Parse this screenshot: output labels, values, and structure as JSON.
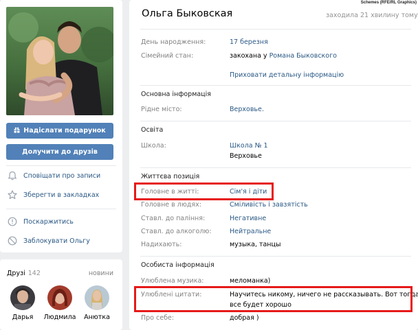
{
  "watermark": "Schemes (RFE/RL Graphics)",
  "profile": {
    "name": "Ольга Быковская",
    "online_status": "заходила 21 хвилину тому"
  },
  "actions": {
    "send_gift": "Надіслати подарунок",
    "add_friend": "Долучити до друзів",
    "notify": "Сповіщати про записи",
    "bookmark": "Зберегти в закладках",
    "report": "Поскаржитись",
    "block": "Заблокувати Ольгу"
  },
  "friends": {
    "title": "Друзі",
    "count": "142",
    "more": "новини",
    "items": [
      {
        "name": "Дарья"
      },
      {
        "name": "Людмила"
      },
      {
        "name": "Анютка"
      }
    ]
  },
  "info": {
    "birthday_label": "День народження:",
    "birthday_value": "17 березня",
    "family_label": "Сімейний стан:",
    "family_prefix": "закохана у",
    "family_partner": "Романа Быковского",
    "hide_details": "Приховати детальну інформацію",
    "basic_title": "Основна інформація",
    "hometown_label": "Рідне місто:",
    "hometown_value": "Верховье.",
    "education_title": "Освіта",
    "school_label": "Школа:",
    "school_value": "Школа № 1",
    "school_city": "Верховье",
    "life_title": "Життєва позиція",
    "main_life_label": "Головне в житті:",
    "main_life_value": "Сім'я і діти",
    "main_people_label": "Головне в людях:",
    "main_people_value": "Сміливість і завзятість",
    "smoking_label": "Ставл. до паління:",
    "smoking_value": "Негативне",
    "alcohol_label": "Ставл. до алкоголю:",
    "alcohol_value": "Нейтральне",
    "inspire_label": "Надихають:",
    "inspire_value": "музыка, танцы",
    "personal_title": "Особиста інформація",
    "music_label": "Улюблена музика:",
    "music_value": "меломанка)",
    "quotes_label": "Улюблені цитати:",
    "quotes_line1": "Научитесь никому, ничего не рассказывать. Вот тогда",
    "quotes_line2": "все будет хорошо",
    "about_label": "Про себе:",
    "about_value": "добрая )"
  },
  "colors": {
    "accent": "#5181b8",
    "link": "#2a5885",
    "highlight": "#e61919",
    "background": "#edeef0"
  }
}
